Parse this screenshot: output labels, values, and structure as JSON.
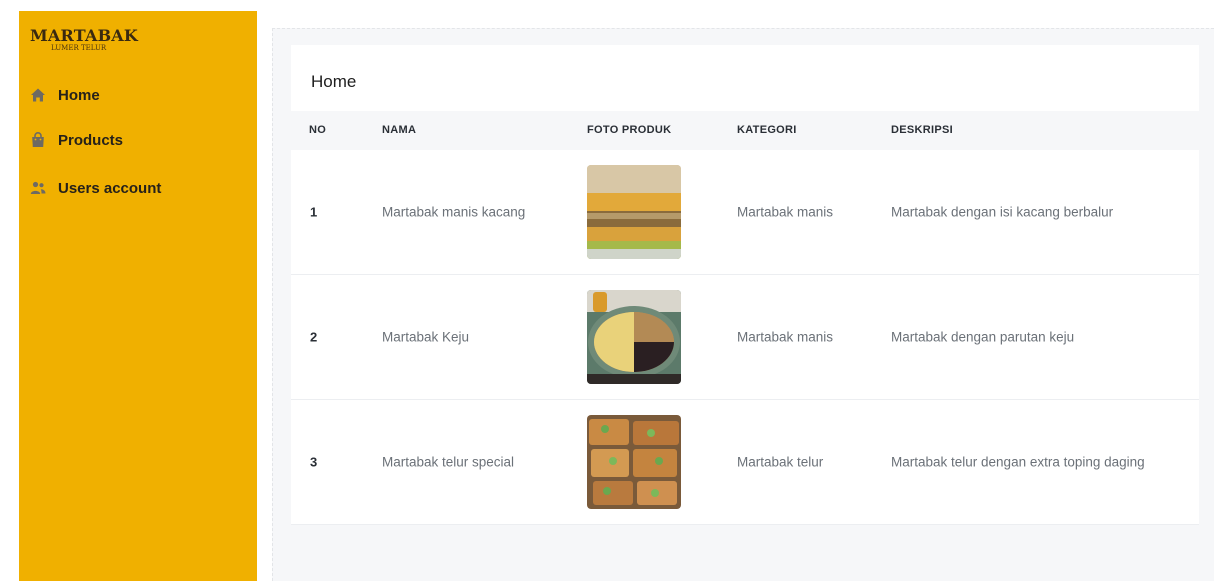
{
  "sidebar": {
    "brand_title": "MARTABAK",
    "brand_subtitle": "LUMER TELUR",
    "items": [
      {
        "label": "Home",
        "icon": "home-icon"
      },
      {
        "label": "Products",
        "icon": "shopping-bag-icon"
      },
      {
        "label": "Users account",
        "icon": "users-icon"
      }
    ]
  },
  "main": {
    "title": "Home",
    "columns": [
      "NO",
      "NAMA",
      "FOTO PRODUK",
      "KATEGORI",
      "DESKRIPSI"
    ],
    "rows": [
      {
        "no": "1",
        "nama": "Martabak manis kacang",
        "kategori": "Martabak manis",
        "deskripsi": "Martabak dengan isi kacang berbalur",
        "photo": "martabak-manis-kacang-photo"
      },
      {
        "no": "2",
        "nama": "Martabak Keju",
        "kategori": "Martabak manis",
        "deskripsi": "Martabak dengan parutan keju",
        "photo": "martabak-keju-photo"
      },
      {
        "no": "3",
        "nama": "Martabak telur special",
        "kategori": "Martabak telur",
        "deskripsi": "Martabak telur dengan extra toping daging",
        "photo": "martabak-telur-photo"
      }
    ]
  },
  "colors": {
    "sidebar_bg": "#f0b000",
    "content_bg": "#f6f7f9",
    "card_bg": "#ffffff"
  }
}
